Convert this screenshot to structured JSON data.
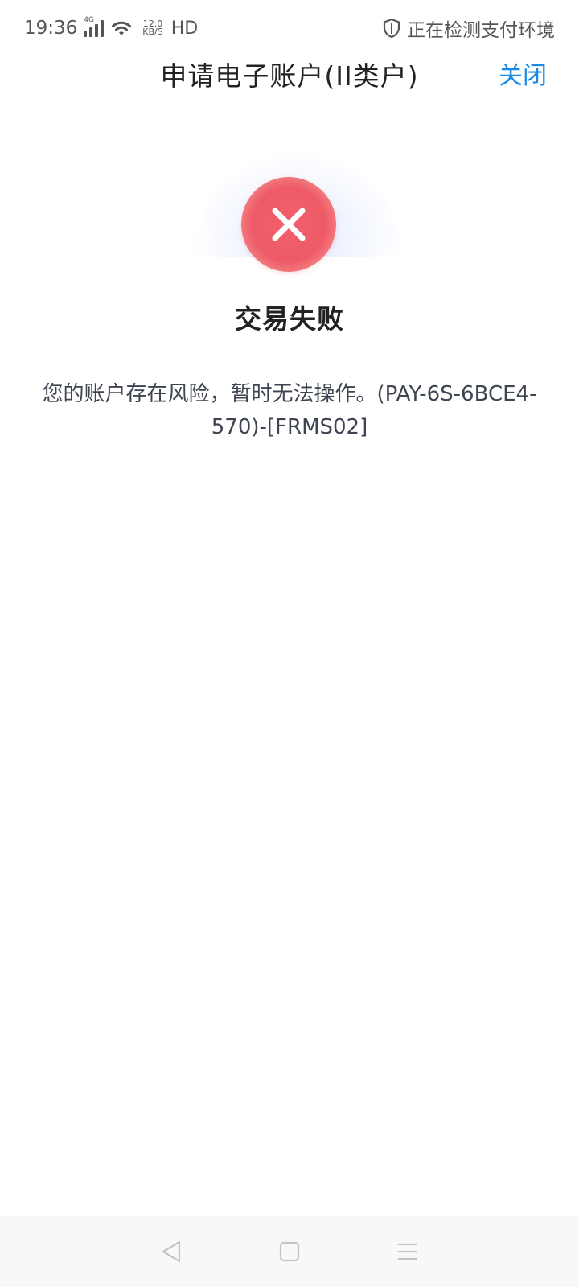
{
  "status_bar": {
    "time": "19:36",
    "network_type": "4G",
    "net_speed_value": "12.0",
    "net_speed_unit": "KB/S",
    "hd_label": "HD",
    "security_status": "正在检测支付环境"
  },
  "header": {
    "title": "申请电子账户(II类户)",
    "close_label": "关闭",
    "accent_color": "#1a8ae6"
  },
  "result": {
    "status_icon": "error-x-icon",
    "title": "交易失败",
    "message": "您的账户存在风险，暂时无法操作。(PAY-6S-6BCE4-570)-[FRMS02]",
    "icon_color": "#ee5a68"
  },
  "nav_bar": {
    "back_icon": "back-triangle-icon",
    "home_icon": "home-square-icon",
    "menu_icon": "menu-lines-icon"
  }
}
